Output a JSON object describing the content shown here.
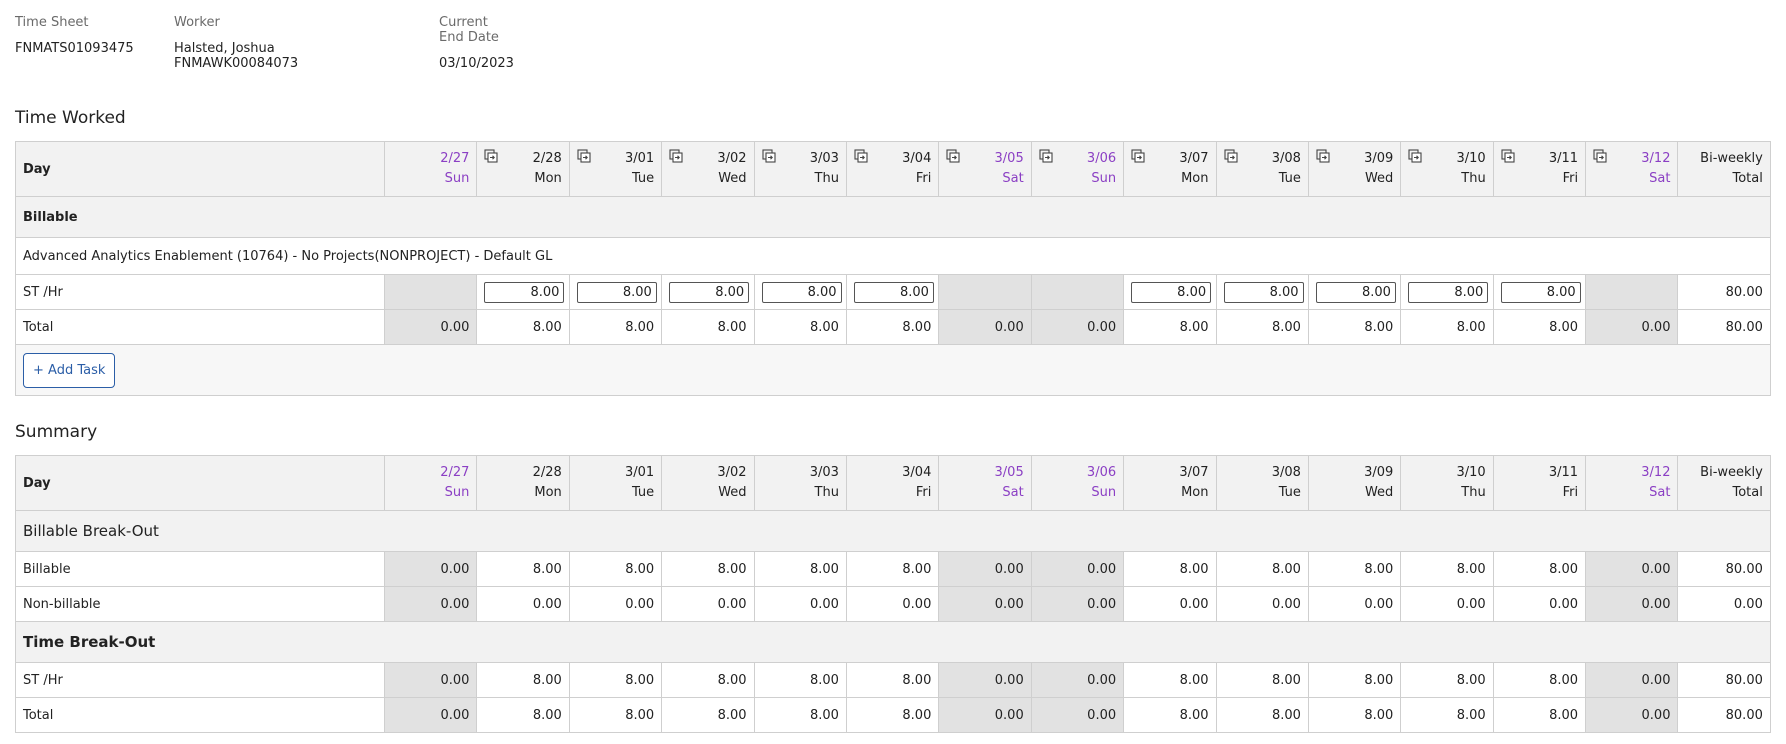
{
  "header": {
    "timesheet_label": "Time Sheet",
    "timesheet_value": "FNMATS01093475",
    "worker_label": "Worker",
    "worker_value": "Halsted, Joshua FNMAWK00084073",
    "end_date_label": "Current End Date",
    "end_date_value": "03/10/2023"
  },
  "days": [
    {
      "date": "2/27",
      "dow": "Sun"
    },
    {
      "date": "2/28",
      "dow": "Mon"
    },
    {
      "date": "3/01",
      "dow": "Tue"
    },
    {
      "date": "3/02",
      "dow": "Wed"
    },
    {
      "date": "3/03",
      "dow": "Thu"
    },
    {
      "date": "3/04",
      "dow": "Fri"
    },
    {
      "date": "3/05",
      "dow": "Sat"
    },
    {
      "date": "3/06",
      "dow": "Sun"
    },
    {
      "date": "3/07",
      "dow": "Mon"
    },
    {
      "date": "3/08",
      "dow": "Tue"
    },
    {
      "date": "3/09",
      "dow": "Wed"
    },
    {
      "date": "3/10",
      "dow": "Thu"
    },
    {
      "date": "3/11",
      "dow": "Fri"
    },
    {
      "date": "3/12",
      "dow": "Sat"
    }
  ],
  "colors": {
    "weekend": "#8b3fc4",
    "shade": "#e2e2e2",
    "accent": "#2b5ea7"
  },
  "icons": {
    "copy": "copy-day-icon"
  },
  "time_worked": {
    "title": "Time Worked",
    "day_label": "Day",
    "total_header": [
      "Bi-weekly",
      "Total"
    ],
    "group_label": "Billable",
    "task_label": "Advanced Analytics Enablement (10764) - No Projects(NONPROJECT) - Default GL",
    "rows": [
      {
        "label": "ST /Hr",
        "values": [
          "",
          "8.00",
          "8.00",
          "8.00",
          "8.00",
          "8.00",
          "",
          "",
          "8.00",
          "8.00",
          "8.00",
          "8.00",
          "8.00",
          ""
        ],
        "total": "80.00"
      },
      {
        "label": "Total",
        "values": [
          "0.00",
          "8.00",
          "8.00",
          "8.00",
          "8.00",
          "8.00",
          "0.00",
          "0.00",
          "8.00",
          "8.00",
          "8.00",
          "8.00",
          "8.00",
          "0.00"
        ],
        "total": "80.00"
      }
    ],
    "add_task_label": "+ Add Task"
  },
  "summary": {
    "title": "Summary",
    "day_label": "Day",
    "total_header": [
      "Bi-weekly",
      "Total"
    ],
    "groups": [
      {
        "label": "Billable Break-Out",
        "rows": [
          {
            "label": "Billable",
            "values": [
              "0.00",
              "8.00",
              "8.00",
              "8.00",
              "8.00",
              "8.00",
              "0.00",
              "0.00",
              "8.00",
              "8.00",
              "8.00",
              "8.00",
              "8.00",
              "0.00"
            ],
            "total": "80.00"
          },
          {
            "label": "Non-billable",
            "values": [
              "0.00",
              "0.00",
              "0.00",
              "0.00",
              "0.00",
              "0.00",
              "0.00",
              "0.00",
              "0.00",
              "0.00",
              "0.00",
              "0.00",
              "0.00",
              "0.00"
            ],
            "total": "0.00"
          }
        ]
      },
      {
        "label": "Time Break-Out",
        "rows": [
          {
            "label": "ST /Hr",
            "values": [
              "0.00",
              "8.00",
              "8.00",
              "8.00",
              "8.00",
              "8.00",
              "0.00",
              "0.00",
              "8.00",
              "8.00",
              "8.00",
              "8.00",
              "8.00",
              "0.00"
            ],
            "total": "80.00"
          },
          {
            "label": "Total",
            "values": [
              "0.00",
              "8.00",
              "8.00",
              "8.00",
              "8.00",
              "8.00",
              "0.00",
              "0.00",
              "8.00",
              "8.00",
              "8.00",
              "8.00",
              "8.00",
              "0.00"
            ],
            "total": "80.00"
          }
        ]
      }
    ]
  }
}
